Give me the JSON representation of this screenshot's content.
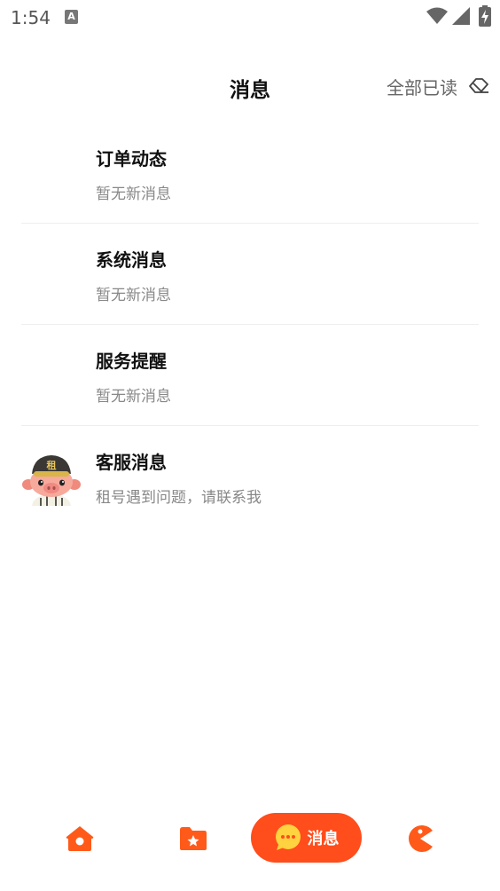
{
  "status_bar": {
    "time": "1:54"
  },
  "header": {
    "title": "消息",
    "mark_all_read_label": "全部已读"
  },
  "messages": [
    {
      "title": "订单动态",
      "subtitle": "暂无新消息"
    },
    {
      "title": "系统消息",
      "subtitle": "暂无新消息"
    },
    {
      "title": "服务提醒",
      "subtitle": "暂无新消息"
    },
    {
      "title": "客服消息",
      "subtitle": "租号遇到问题，请联系我",
      "avatar_badge": "租"
    }
  ],
  "bottom_nav": {
    "active_label": "消息",
    "items": [
      {
        "icon": "home-icon"
      },
      {
        "icon": "folder-star-icon"
      },
      {
        "icon": "chat-icon"
      },
      {
        "icon": "pacman-icon"
      }
    ]
  },
  "colors": {
    "accent": "#ff4d1c",
    "icon_orange": "#ff5a1a",
    "title_text": "#111111",
    "secondary_text": "#888888",
    "divider": "#eeeeee"
  }
}
